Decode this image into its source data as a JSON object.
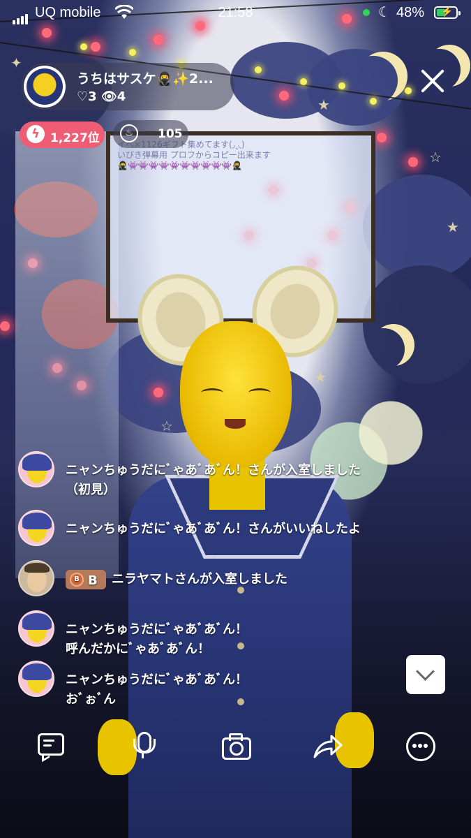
{
  "status_bar": {
    "carrier": "UQ mobile",
    "time": "21:58",
    "battery_percent": "48%",
    "battery_level": 0.48,
    "icons": [
      "signal-icon",
      "wifi-icon",
      "green-dot-icon",
      "moon-icon",
      "battery-charging-icon"
    ]
  },
  "host": {
    "name": "うちはサスケ🥷✨2...",
    "likes": "♡3",
    "viewers": "👁4"
  },
  "rank": {
    "value": "1,227位",
    "icon": "lightning-icon"
  },
  "points": {
    "value": "105",
    "icon": "flame-icon"
  },
  "board": {
    "line1": "イベ×1126ギフト集めてます(◞‸◟)",
    "line2": "いびき弾幕用 プロフからコピー出来ます",
    "line3": "🥷👾👾👾👾👾👾👾👾👾👾🥷"
  },
  "chat": [
    {
      "lines": [
        "ニャンちゅうだにﾞゃあﾞあﾞん！さんが入室しました",
        "（初見）"
      ]
    },
    {
      "lines": [
        "ニャンちゅうだにﾞゃあﾞあﾞん！さんがいいねしたよ"
      ]
    },
    {
      "badge": "B",
      "lines": [
        "ニラヤマトさんが入室しました"
      ]
    },
    {
      "lines": [
        "ニャンちゅうだにﾞゃあﾞあﾞん！",
        "呼んだかにﾞゃあﾞあﾞん！"
      ]
    },
    {
      "lines": [
        "ニャンちゅうだにﾞゃあﾞあﾞん！",
        "おﾞぉﾞん"
      ]
    }
  ],
  "toolbar": [
    "comment-icon",
    "microphone-icon",
    "camera-icon",
    "share-icon",
    "more-icon"
  ],
  "colors": {
    "rank_bg": "#ee5d74",
    "battery_green": "#33d158"
  }
}
